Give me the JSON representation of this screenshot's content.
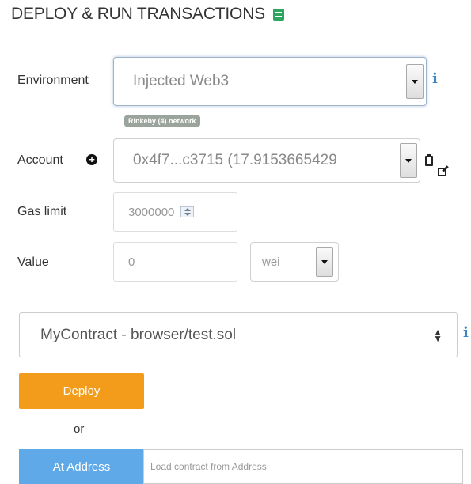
{
  "header": {
    "title": "DEPLOY & RUN TRANSACTIONS",
    "icon": "plugin-icon",
    "icon_color": "#2ea55f"
  },
  "environment": {
    "label": "Environment",
    "selected": "Injected Web3",
    "network_badge": "Rinkeby (4) network",
    "info_icon": "i"
  },
  "account": {
    "label": "Account",
    "selected": "0x4f7...c3715 (17.9153665429"
  },
  "gas_limit": {
    "label": "Gas limit",
    "value": "3000000"
  },
  "value": {
    "label": "Value",
    "amount": "0",
    "unit": "wei"
  },
  "contract": {
    "selected": "MyContract - browser/test.sol",
    "info_icon": "i"
  },
  "deploy": {
    "label": "Deploy",
    "color": "#f39c1b"
  },
  "or_text": "or",
  "at_address": {
    "label": "At Address",
    "placeholder": "Load contract from Address",
    "color": "#5fa9e8"
  }
}
